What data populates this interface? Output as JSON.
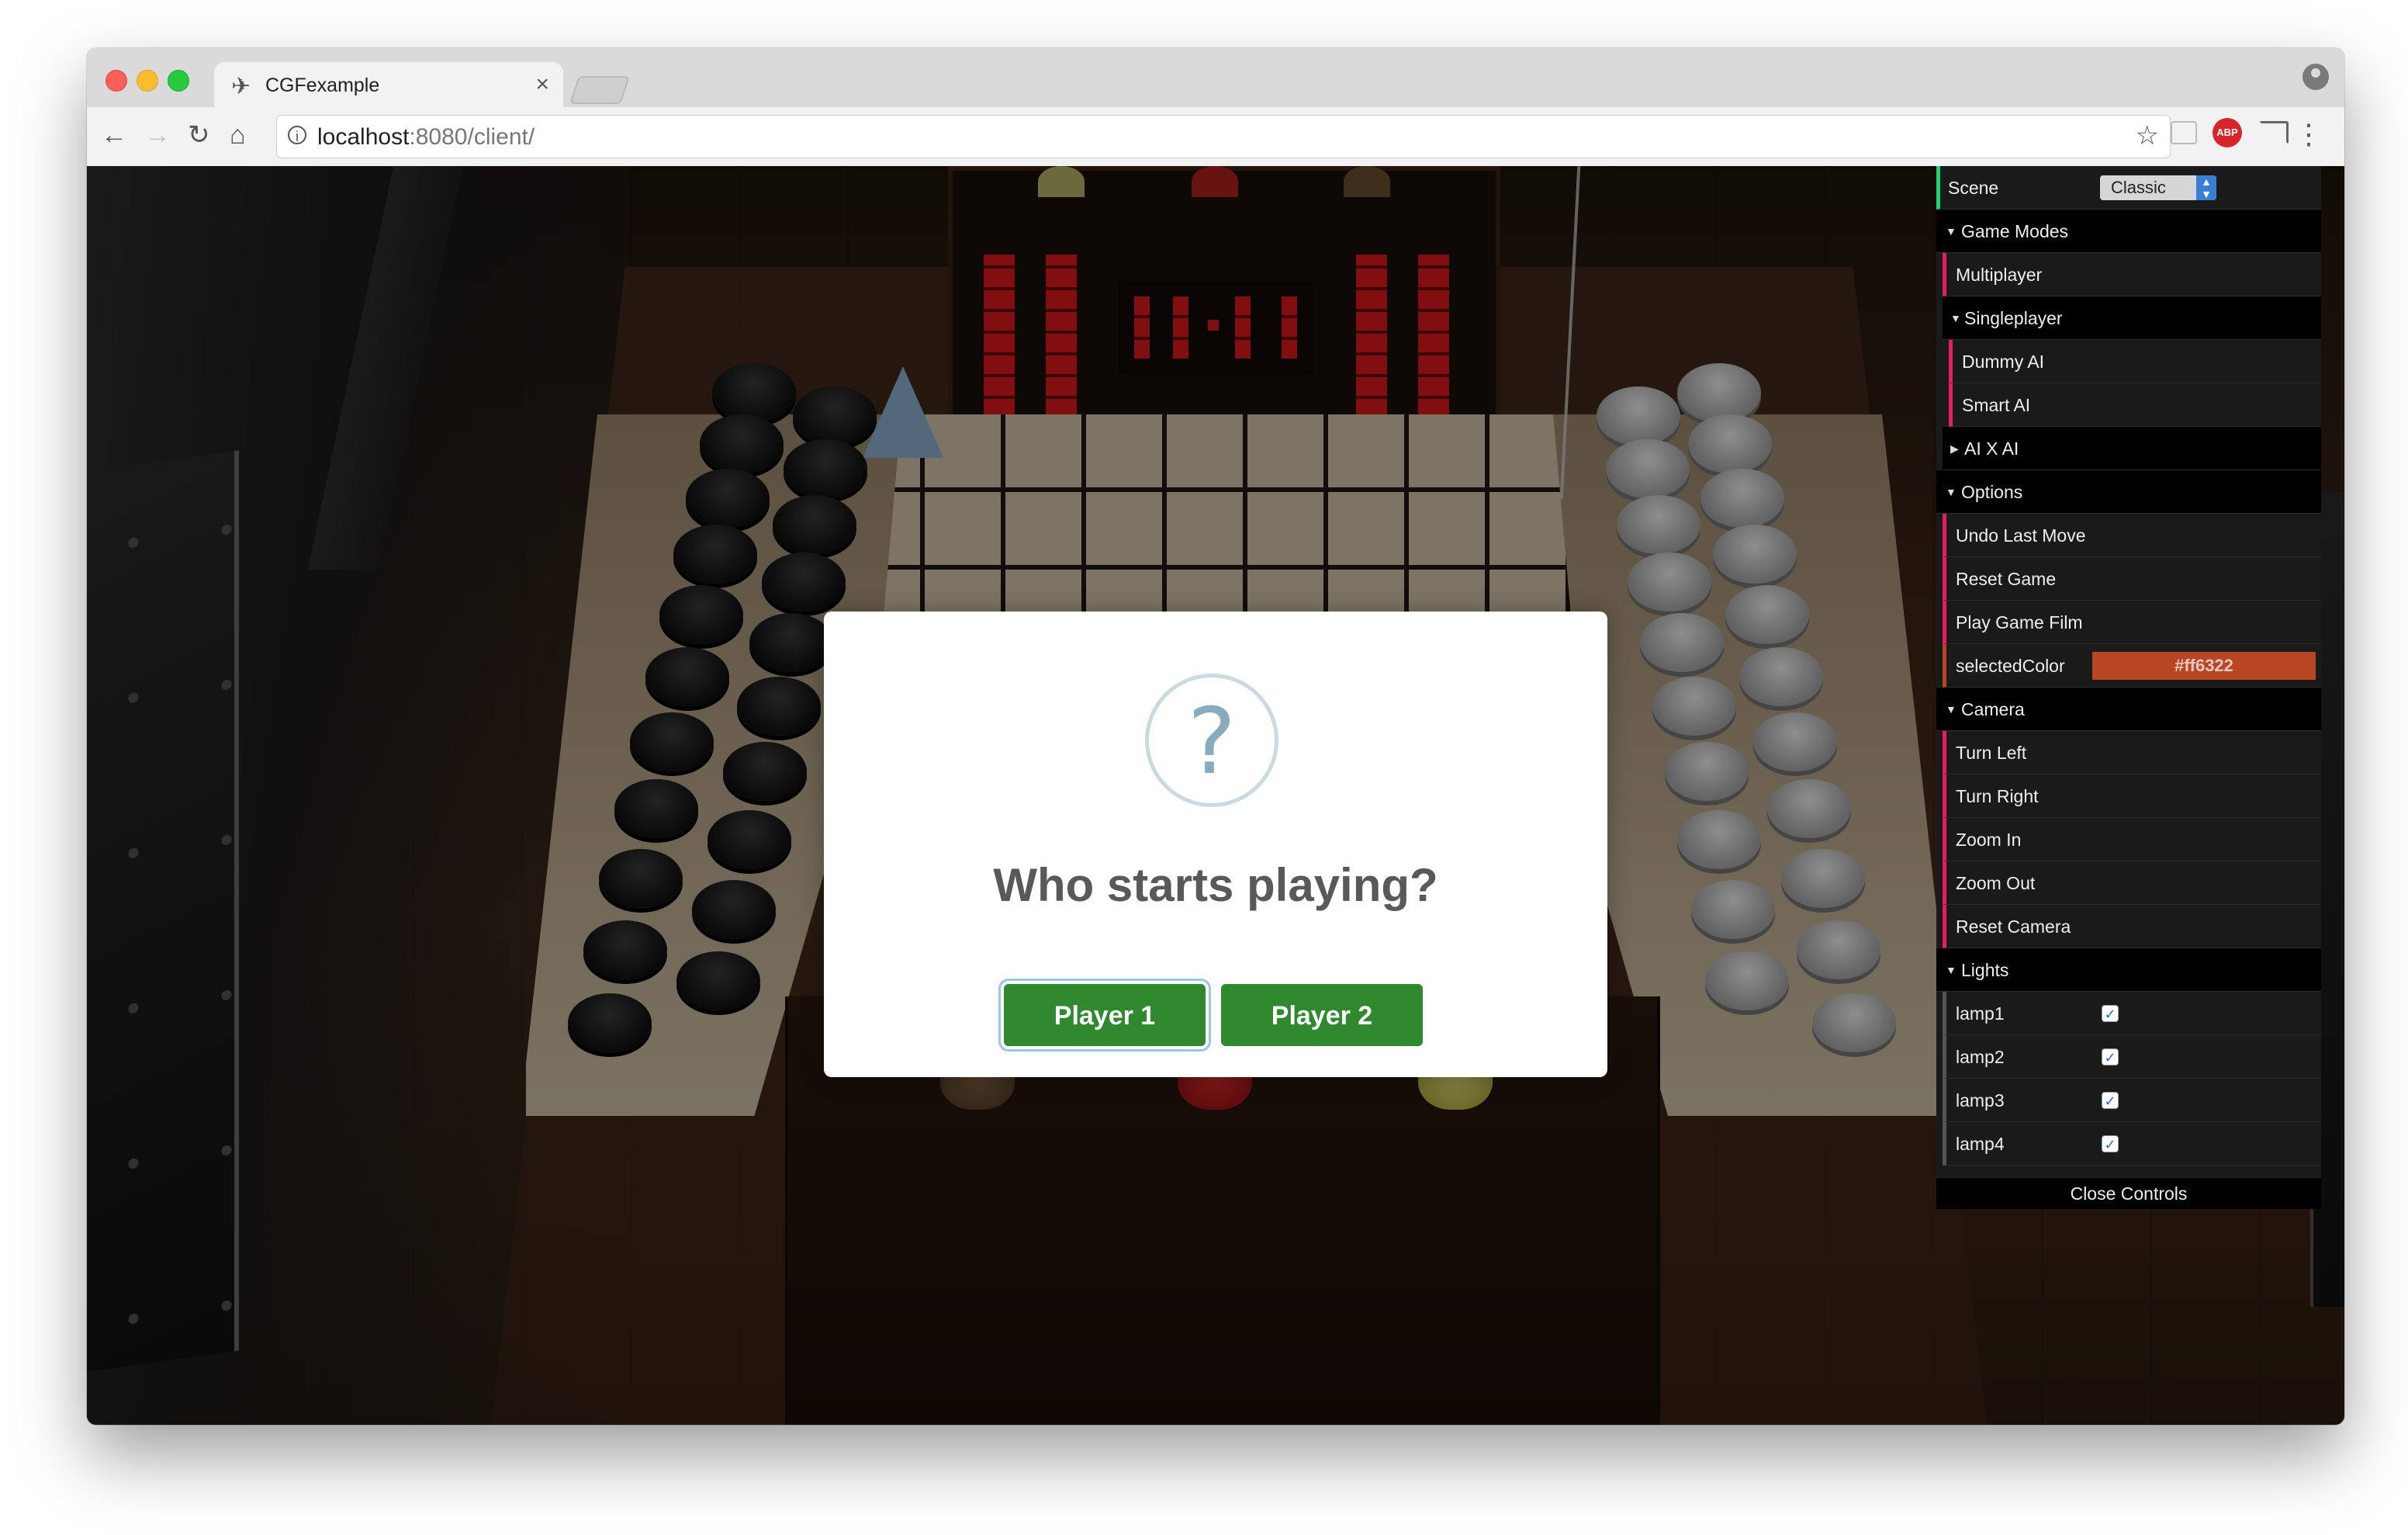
{
  "browser": {
    "tab_title": "CGFexample",
    "tab_close": "×",
    "url_host": "localhost",
    "url_rest": ":8080/client/",
    "abp_label": "ABP"
  },
  "modal": {
    "icon": "?",
    "title": "Who starts playing?",
    "buttons": [
      "Player 1",
      "Player 2"
    ]
  },
  "controls": {
    "scene_label": "Scene",
    "scene_value": "Classic",
    "game_modes": "Game Modes",
    "multiplayer": "Multiplayer",
    "singleplayer": "Singleplayer",
    "dummy_ai": "Dummy AI",
    "smart_ai": "Smart AI",
    "ai_x_ai": "AI X AI",
    "options": "Options",
    "undo": "Undo Last Move",
    "reset_game": "Reset Game",
    "play_film": "Play Game Film",
    "selected_color_label": "selectedColor",
    "selected_color_value": "#ff6322",
    "camera": "Camera",
    "turn_left": "Turn Left",
    "turn_right": "Turn Right",
    "zoom_in": "Zoom In",
    "zoom_out": "Zoom Out",
    "reset_camera": "Reset Camera",
    "lights": "Lights",
    "lamp1": "lamp1",
    "lamp2": "lamp2",
    "lamp3": "lamp3",
    "lamp4": "lamp4",
    "close_controls": "Close Controls"
  },
  "lights_state": {
    "lamp1": true,
    "lamp2": true,
    "lamp3": true,
    "lamp4": true
  },
  "colors": {
    "accent_button": "#2f8a2f",
    "selected_color": "#ff6322",
    "scoreboard_digits": "#e01b1b"
  }
}
